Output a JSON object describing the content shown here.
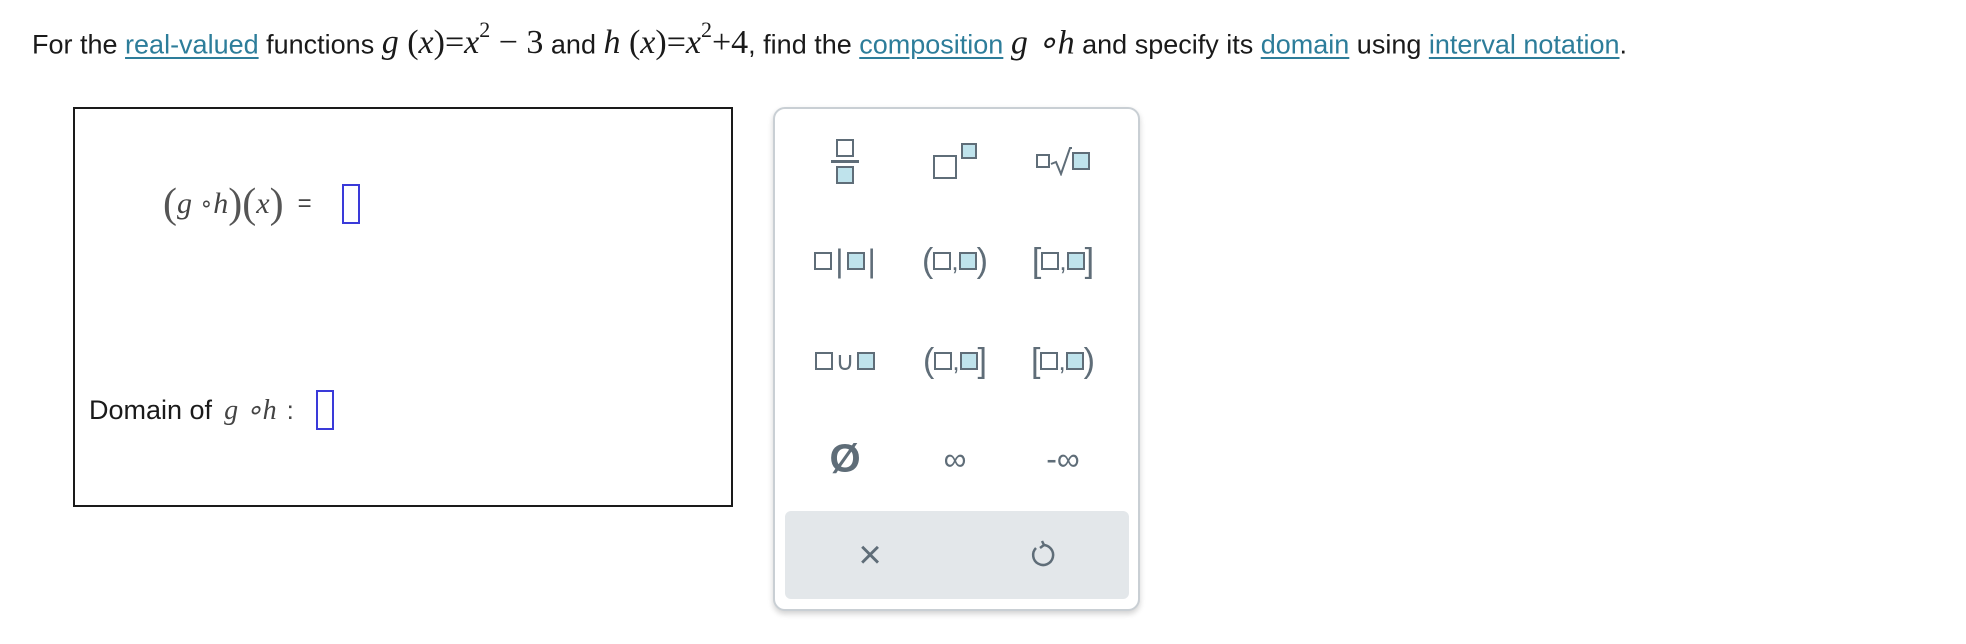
{
  "question": {
    "t1": "For the ",
    "link_real": "real-valued",
    "t2": " functions ",
    "g_def": "g(x) = x² − 3",
    "t3": " and ",
    "h_def": "h(x) = x² + 4",
    "t4": ", find the ",
    "link_composition": "composition",
    "t5": " ",
    "comp": "g ∘h",
    "t6": " and specify its ",
    "link_domain": "domain",
    "t7": " using ",
    "link_interval": "interval notation",
    "t8": "."
  },
  "answer": {
    "comp_label": "(g ∘h)(x)",
    "equals": "=",
    "comp_value": "",
    "domain_label": "Domain of",
    "domain_math": "g ∘h",
    "domain_colon": ":",
    "domain_value": ""
  },
  "palette": {
    "buttons": [
      "fraction",
      "superscript",
      "nth-root",
      "absolute-value",
      "open-interval",
      "closed-interval",
      "union",
      "half-open-left",
      "half-open-right",
      "empty-set",
      "infinity",
      "negative-infinity"
    ],
    "symbols": {
      "empty_set": "Ø",
      "infinity": "∞",
      "neg_infinity": "-∞",
      "union": "∪",
      "clear": "×"
    },
    "footer": [
      "clear",
      "reset"
    ]
  },
  "colors": {
    "link": "#2d7d9a",
    "input_border": "#3a3ad9",
    "palette_icon": "#5f6d78",
    "highlight_square": "#bfe3ec"
  }
}
